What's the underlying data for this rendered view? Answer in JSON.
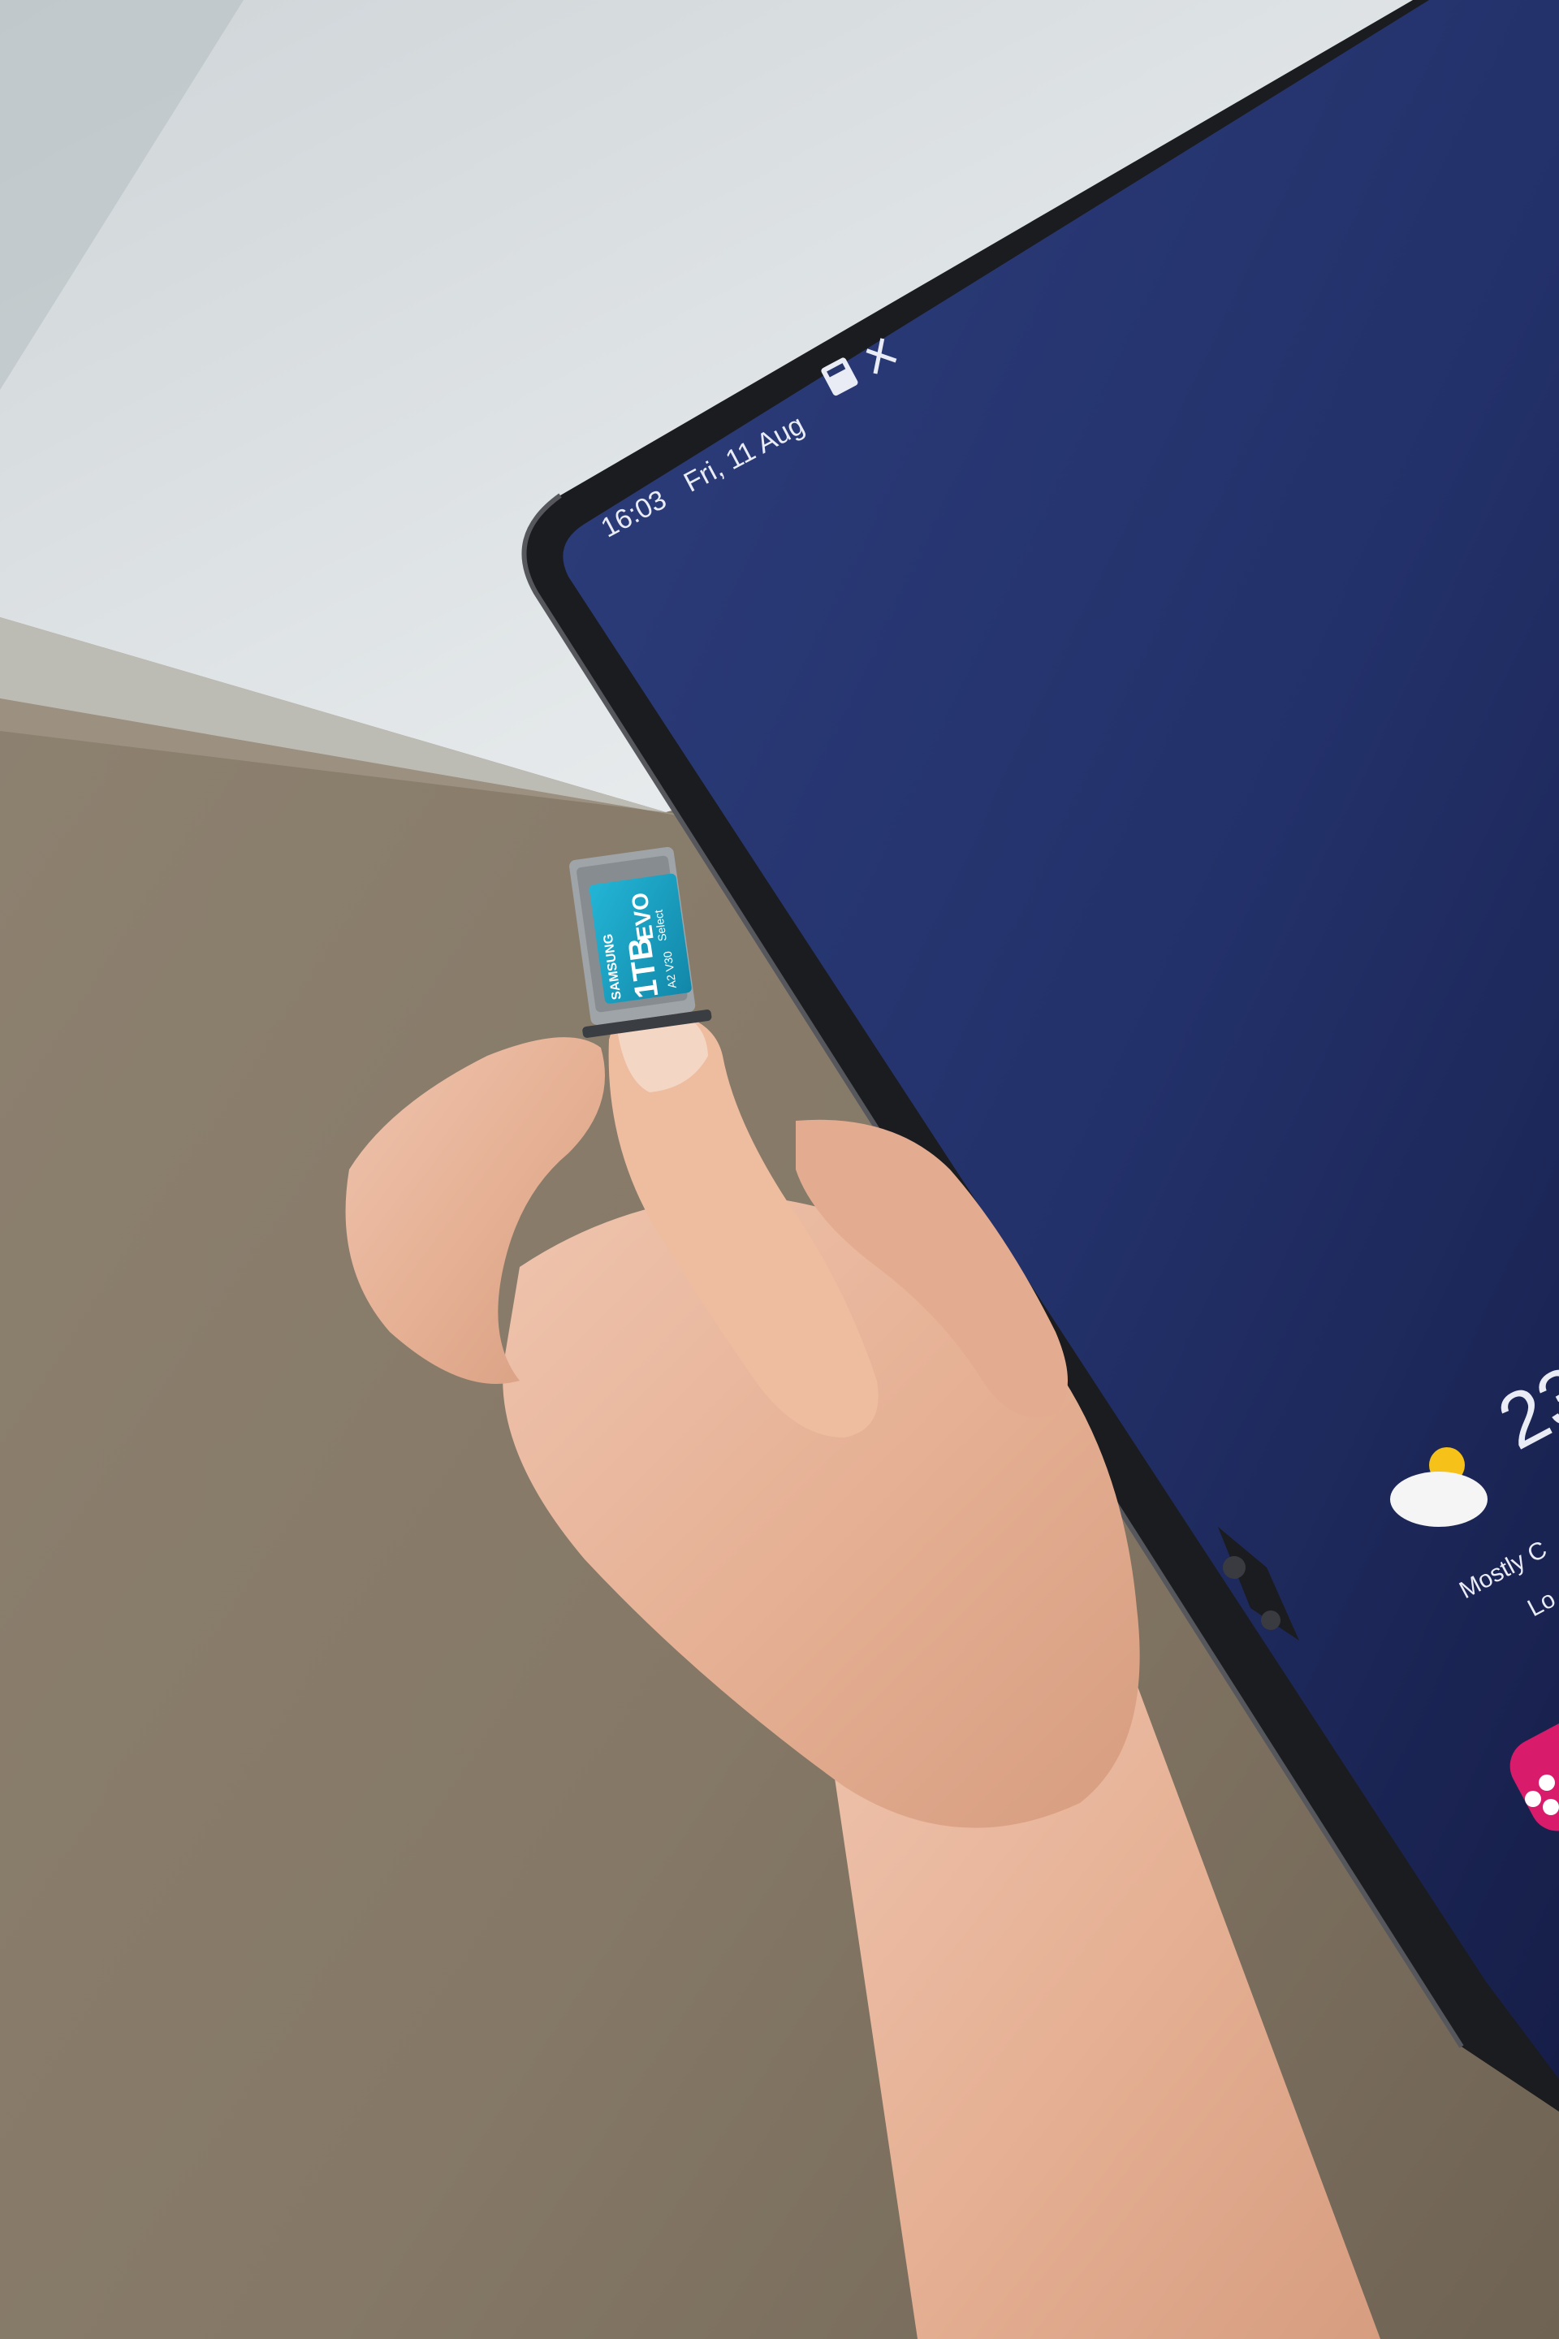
{
  "status_bar": {
    "time": "16:03",
    "date": "Fri, 11 Aug",
    "icons": [
      "microsd-card-icon",
      "no-signal-icon"
    ]
  },
  "weather_widget": {
    "temperature": "23",
    "condition": "Mostly C",
    "location": "Lo",
    "icon": "partly-cloudy-icon"
  },
  "memory_card": {
    "brand": "SAMSUNG",
    "capacity": "1TB",
    "line": "EVO",
    "variant": "Select",
    "rating": "A2 V30"
  },
  "colors": {
    "wallpaper": "#28366e",
    "card": "#1aa6c8",
    "table": "#8c7e6c",
    "app_icon": "#d81b6b"
  }
}
